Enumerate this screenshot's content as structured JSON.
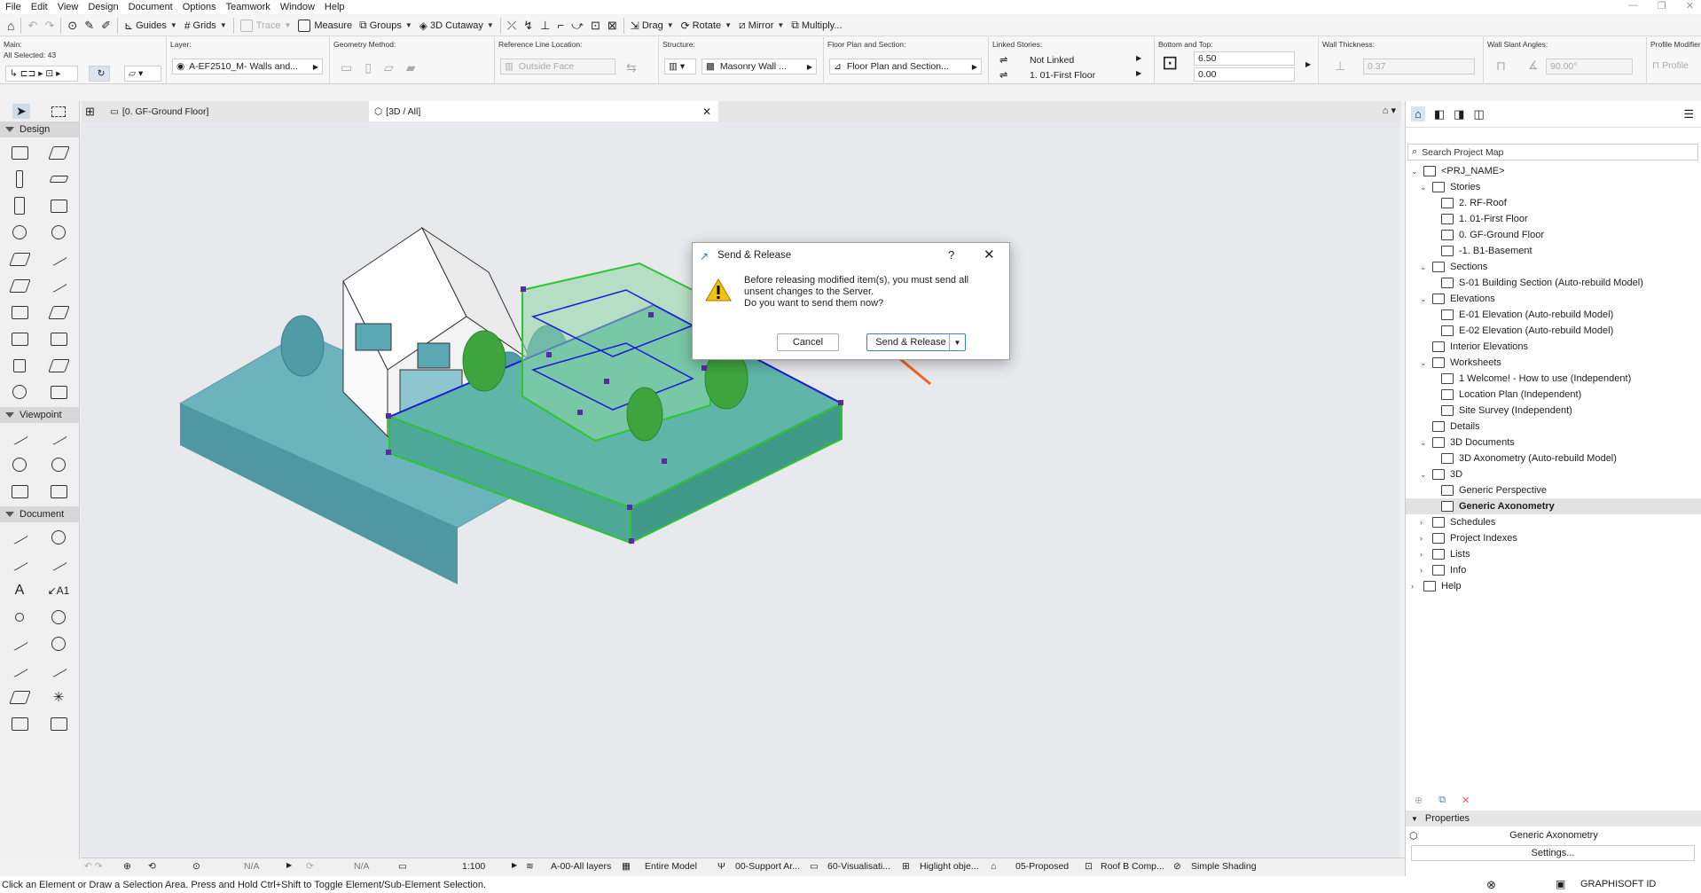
{
  "menu": [
    "File",
    "Edit",
    "View",
    "Design",
    "Document",
    "Options",
    "Teamwork",
    "Window",
    "Help"
  ],
  "toolbar": {
    "guides": "Guides",
    "grids": "Grids",
    "trace": "Trace",
    "measure": "Measure",
    "groups": "Groups",
    "cutaway": "3D Cutaway",
    "drag": "Drag",
    "rotate": "Rotate",
    "mirror": "Mirror",
    "multiply": "Multiply..."
  },
  "infobox": {
    "main_label": "Main:",
    "selected": "All Selected: 43",
    "layer_label": "Layer:",
    "layer_value": "A-EF2510_M- Walls and...",
    "geom_label": "Geometry Method:",
    "refline_label": "Reference Line Location:",
    "refline_value": "Outside Face",
    "structure_label": "Structure:",
    "structure_value": "Masonry Wall ...",
    "floorplan_label": "Floor Plan and Section:",
    "floorplan_value": "Floor Plan and Section...",
    "linked_label": "Linked Stories:",
    "linked_top": "Not Linked",
    "linked_bottom": "1. 01-First Floor",
    "bt_label": "Bottom and Top:",
    "top_value": "6.50",
    "bottom_value": "0.00",
    "thickness_label": "Wall Thickness:",
    "thickness_value": "0.37",
    "slant_label": "Wall Slant Angles:",
    "slant_value": "90.00°",
    "profile_label": "Profile Modifier:",
    "profile_value": "Profile"
  },
  "tabs": {
    "floor": "[0. GF-Ground Floor]",
    "view3d": "[3D / All]"
  },
  "toolbox": {
    "design": "Design",
    "viewpoint": "Viewpoint",
    "document": "Document"
  },
  "navigator": {
    "search_placeholder": "Search Project Map",
    "items": [
      {
        "label": "<PRJ_NAME>",
        "level": 0,
        "exp": "v"
      },
      {
        "label": "Stories",
        "level": 1,
        "exp": "v"
      },
      {
        "label": "2. RF-Roof",
        "level": 2,
        "exp": ""
      },
      {
        "label": "1. 01-First Floor",
        "level": 2,
        "exp": ""
      },
      {
        "label": "0. GF-Ground Floor",
        "level": 2,
        "exp": ""
      },
      {
        "label": "-1. B1-Basement",
        "level": 2,
        "exp": ""
      },
      {
        "label": "Sections",
        "level": 1,
        "exp": "v"
      },
      {
        "label": "S-01 Building Section (Auto-rebuild Model)",
        "level": 2,
        "exp": ""
      },
      {
        "label": "Elevations",
        "level": 1,
        "exp": "v"
      },
      {
        "label": "E-01 Elevation (Auto-rebuild Model)",
        "level": 2,
        "exp": ""
      },
      {
        "label": "E-02 Elevation (Auto-rebuild Model)",
        "level": 2,
        "exp": ""
      },
      {
        "label": "Interior Elevations",
        "level": 1,
        "exp": ""
      },
      {
        "label": "Worksheets",
        "level": 1,
        "exp": "v"
      },
      {
        "label": "1 Welcome! - How to use (Independent)",
        "level": 2,
        "exp": ""
      },
      {
        "label": "Location Plan (Independent)",
        "level": 2,
        "exp": ""
      },
      {
        "label": "Site Survey (Independent)",
        "level": 2,
        "exp": ""
      },
      {
        "label": "Details",
        "level": 1,
        "exp": ""
      },
      {
        "label": "3D Documents",
        "level": 1,
        "exp": "v"
      },
      {
        "label": "3D Axonometry (Auto-rebuild Model)",
        "level": 2,
        "exp": ""
      },
      {
        "label": "3D",
        "level": 1,
        "exp": "v"
      },
      {
        "label": "Generic Perspective",
        "level": 2,
        "exp": ""
      },
      {
        "label": "Generic Axonometry",
        "level": 2,
        "exp": "",
        "selected": true
      },
      {
        "label": "Schedules",
        "level": 1,
        "exp": ">"
      },
      {
        "label": "Project Indexes",
        "level": 1,
        "exp": ">"
      },
      {
        "label": "Lists",
        "level": 1,
        "exp": ">"
      },
      {
        "label": "Info",
        "level": 1,
        "exp": ">"
      },
      {
        "label": "Help",
        "level": 0,
        "exp": ">"
      }
    ],
    "properties_label": "Properties",
    "properties_value": "Generic Axonometry",
    "settings": "Settings...",
    "brand": "GRAPHISOFT ID"
  },
  "statusbar": {
    "na1": "N/A",
    "na2": "N/A",
    "scale": "1:100",
    "layers": "A-00-All layers",
    "model": "Entire Model",
    "support": "00-Support Ar...",
    "visual": "60-Visualisati...",
    "highlight": "Higlight obje...",
    "proposed": "05-Proposed",
    "roof": "Roof B Comp...",
    "shading": "Simple Shading"
  },
  "hint": "Click an Element or Draw a Selection Area. Press and Hold Ctrl+Shift to Toggle Element/Sub-Element Selection.",
  "dialog": {
    "title": "Send & Release",
    "help": "?",
    "message_1": "Before releasing modified item(s), you must send all",
    "message_2": "unsent changes to the Server.",
    "message_3": "Do you want to send them now?",
    "cancel": "Cancel",
    "confirm": "Send & Release"
  },
  "colors": {
    "accent": "#f26522",
    "selection": "#1a1ad6",
    "model_teal": "#5aaeb8",
    "green": "#2ec52e"
  }
}
